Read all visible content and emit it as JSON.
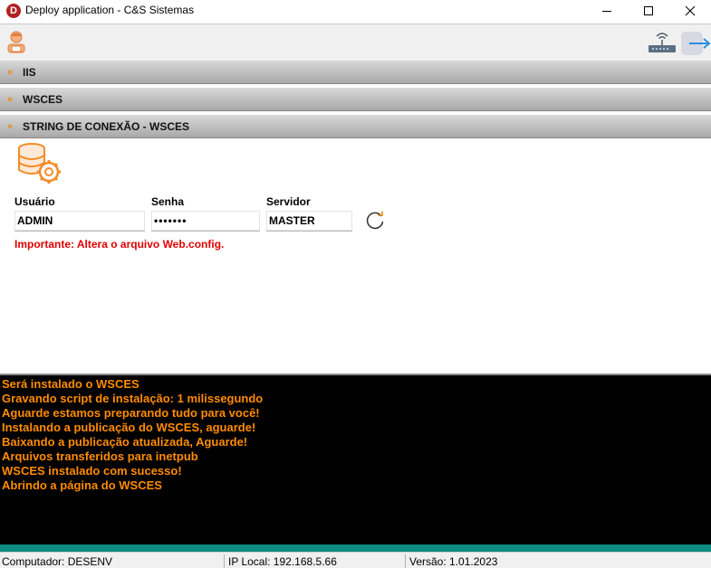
{
  "window": {
    "title": "Deploy application - C&S Sistemas",
    "app_icon_letter": "D"
  },
  "toolbar": {
    "user_icon": "user-icon",
    "network_icon": "network-router-icon",
    "logout_icon": "logout-arrow-icon"
  },
  "sections": [
    {
      "label": "IIS",
      "chevron": "»"
    },
    {
      "label": "WSCES",
      "chevron": "»"
    },
    {
      "label": "STRING DE CONEXÃO - WSCES",
      "chevron": "»"
    }
  ],
  "form": {
    "usuario": {
      "label": "Usuário",
      "value": "ADMIN"
    },
    "senha": {
      "label": "Senha",
      "value": "•••••••"
    },
    "servidor": {
      "label": "Servidor",
      "value": "MASTER"
    },
    "warning": "Importante: Altera o arquivo Web.config."
  },
  "console": {
    "lines": [
      "Será instalado o WSCES",
      "Gravando script de instalação: 1 milissegundo",
      "Aguarde estamos preparando tudo para você!",
      "Instalando a publicação do WSCES, aguarde!",
      "Baixando a publicação atualizada, Aguarde!",
      "Arquivos transferidos para inetpub",
      "WSCES instalado com sucesso!",
      "Abrindo a página do WSCES"
    ]
  },
  "status": {
    "computer": "Computador: DESENV",
    "ip": "IP Local: 192.168.5.66",
    "version": "Versão: 1.01.2023"
  },
  "colors": {
    "accent_orange": "#ff8c00",
    "warning_red": "#e00000",
    "teal": "#0f8a80"
  }
}
